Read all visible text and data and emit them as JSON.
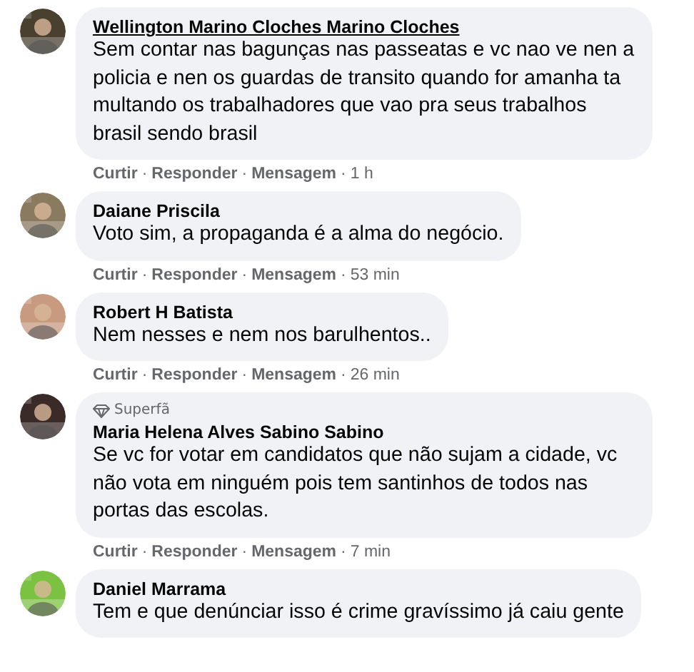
{
  "comments": [
    {
      "author": "Wellington Marino Cloches Marino Cloches",
      "underlined": true,
      "text": "Sem contar nas bagunças nas passeatas e vc nao ve nen a policia e nen os guardas de transito quando for amanha ta multando os trabalhadores que vao pra seus trabalhos brasil sendo brasil",
      "actions": [
        "Curtir",
        "Responder",
        "Mensagem"
      ],
      "separator": "·",
      "time": "1 h"
    },
    {
      "author": "Daiane Priscila",
      "underlined": false,
      "text": "Voto sim, a propaganda é a alma do negócio.",
      "actions": [
        "Curtir",
        "Responder",
        "Mensagem"
      ],
      "separator": "·",
      "time": "53 min"
    },
    {
      "author": "Robert H Batista",
      "underlined": false,
      "text": "Nem nesses e nem nos barulhentos..",
      "actions": [
        "Curtir",
        "Responder",
        "Mensagem"
      ],
      "separator": "·",
      "time": "26 min"
    },
    {
      "author": "Maria Helena Alves Sabino Sabino",
      "underlined": false,
      "badge": "Superfã",
      "text": "Se vc for votar em candidatos que não sujam a cidade, vc não vota em ninguém pois tem santinhos de todos nas portas das escolas.",
      "actions": [
        "Curtir",
        "Responder",
        "Mensagem"
      ],
      "separator": "·",
      "time": "7 min"
    },
    {
      "author": "Daniel Marrama",
      "underlined": false,
      "text": "Tem e que denúnciar isso é crime gravíssimo já caiu gente"
    }
  ]
}
